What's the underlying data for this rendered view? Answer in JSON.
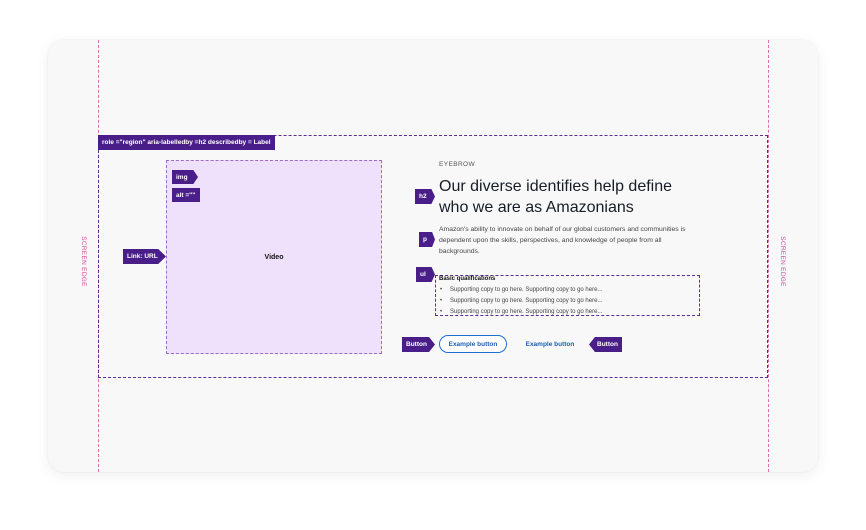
{
  "annotations": {
    "region_label": "role =\"region\"  aria-labelledby =h2  describedby = Label",
    "screen_edge": "SCREEN EDGE",
    "img_tag": "img",
    "alt_tag": "alt =\"\"",
    "link_tag": "Link:  URL",
    "h2_tag": "h2",
    "p_tag": "p",
    "ul_tag": "ul",
    "button_tag": "Button"
  },
  "media": {
    "video_label": "Video"
  },
  "content": {
    "eyebrow": "EYEBROW",
    "heading": "Our diverse identifies help define who we are as Amazonians",
    "paragraph": "Amazon's ability to innovate on behalf of our global customers and communities is dependent upon the skills, perspectives, and knowledge of people from all backgrounds.",
    "list_title": "Basic qualifications",
    "list_items": [
      "Supporting copy to go here. Supporting copy to go here...",
      "Supporting copy to go here. Supporting copy to go here...",
      "Supporting copy to go here. Supporting copy to go here..."
    ]
  },
  "buttons": {
    "primary_label": "Example button",
    "secondary_label": "Example button"
  },
  "colors": {
    "annotation_purple": "#4a1e88",
    "video_fill": "#efe1fb",
    "screen_edge_pink": "#d64ca0",
    "link_blue": "#1b5fb5",
    "button_border": "#1f6fd6"
  }
}
